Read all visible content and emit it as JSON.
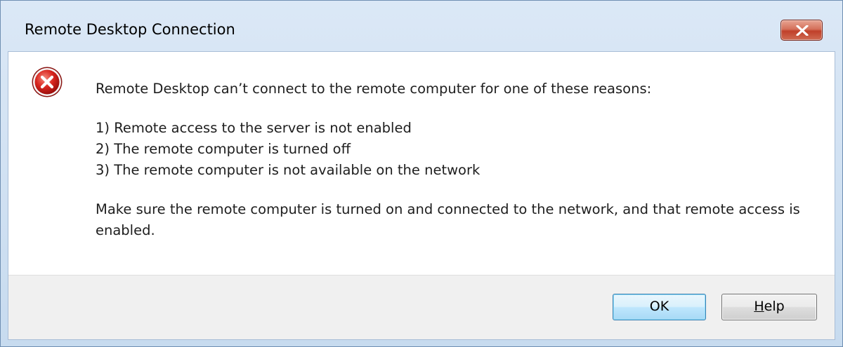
{
  "window": {
    "title": "Remote Desktop Connection",
    "close_icon": "close-x-icon"
  },
  "dialog": {
    "icon": "error-icon",
    "intro": "Remote Desktop can’t connect to the remote computer for one of these reasons:",
    "reasons": [
      "1) Remote access to the server is not enabled",
      "2) The remote computer is turned off",
      "3) The remote computer is not available on the network"
    ],
    "advice": "Make sure the remote computer is turned on and connected to the network, and that remote access is enabled."
  },
  "buttons": {
    "ok_label": "OK",
    "help_label_mnemonic": "H",
    "help_label_rest": "elp"
  },
  "colors": {
    "title_bar": "#d6e5f5",
    "error_red": "#c8201c",
    "ok_border": "#3c7fb1"
  }
}
